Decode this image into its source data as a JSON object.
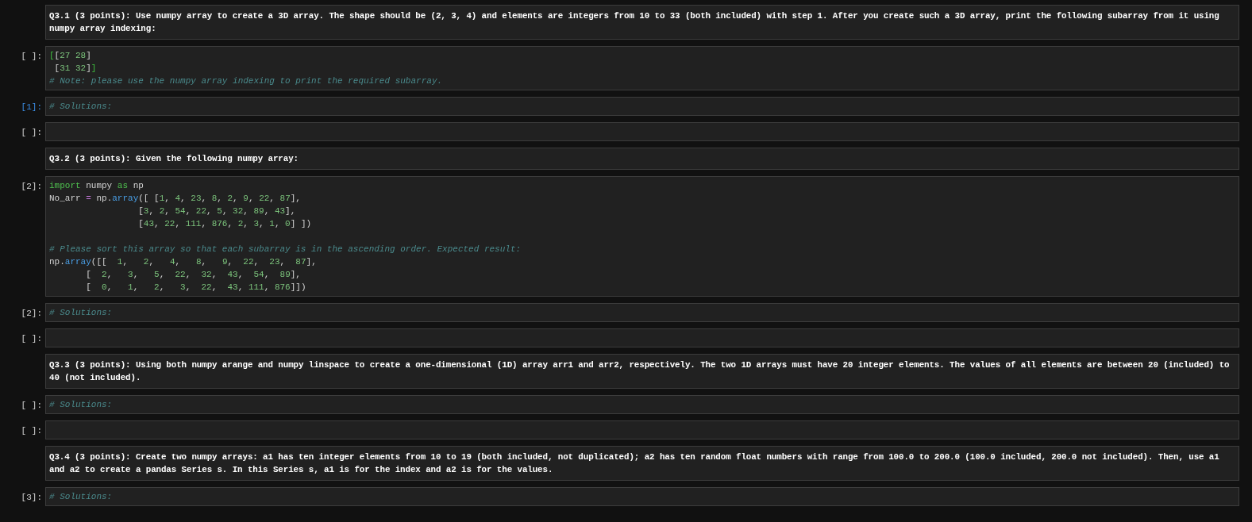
{
  "cells": [
    {
      "kind": "markdown",
      "text": "Q3.1 (3 points): Use numpy array to create a 3D array. The shape should be (2, 3, 4) and elements are integers from 10 to 33 (both included) with step 1. After you create such a 3D array, print the following subarray from it using numpy array indexing:"
    },
    {
      "kind": "code",
      "prompt": "[ ]:",
      "selected": false,
      "lines": [
        {
          "tokens": [
            {
              "text": "[",
              "kind": "bracket"
            },
            {
              "text": "[",
              "kind": "plain"
            },
            {
              "text": "27",
              "kind": "number"
            },
            {
              "text": " 28",
              "kind": "number"
            },
            {
              "text": "]",
              "kind": "plain"
            }
          ]
        },
        {
          "tokens": [
            {
              "text": " [",
              "kind": "plain"
            },
            {
              "text": "31",
              "kind": "number"
            },
            {
              "text": " 32",
              "kind": "number"
            },
            {
              "text": "]",
              "kind": "plain"
            },
            {
              "text": "]",
              "kind": "bracket"
            }
          ]
        },
        {
          "tokens": [
            {
              "text": "# Note: please use the numpy array indexing to print the required subarray.",
              "kind": "comment"
            }
          ]
        }
      ]
    },
    {
      "kind": "code",
      "prompt": "[1]:",
      "selected": true,
      "lines": [
        {
          "tokens": [
            {
              "text": "# Solutions:",
              "kind": "comment"
            }
          ]
        }
      ]
    },
    {
      "kind": "code",
      "prompt": "[ ]:",
      "selected": false
    },
    {
      "kind": "markdown",
      "text": "Q3.2 (3 points): Given the following numpy array:"
    },
    {
      "kind": "code",
      "prompt": "[2]:",
      "selected": false,
      "lines": [
        {
          "tokens": [
            {
              "text": "import",
              "kind": "keyword"
            },
            {
              "text": " numpy ",
              "kind": "plain"
            },
            {
              "text": "as",
              "kind": "keyword"
            },
            {
              "text": " np",
              "kind": "plain"
            }
          ]
        },
        {
          "tokens": [
            {
              "text": "No_arr ",
              "kind": "plain"
            },
            {
              "text": "=",
              "kind": "operator"
            },
            {
              "text": " np.",
              "kind": "plain"
            },
            {
              "text": "array",
              "kind": "function"
            },
            {
              "text": "([ [",
              "kind": "plain"
            },
            {
              "text": "1",
              "kind": "number"
            },
            {
              "text": ", ",
              "kind": "plain"
            },
            {
              "text": "4",
              "kind": "number"
            },
            {
              "text": ", ",
              "kind": "plain"
            },
            {
              "text": "23",
              "kind": "number"
            },
            {
              "text": ", ",
              "kind": "plain"
            },
            {
              "text": "8",
              "kind": "number"
            },
            {
              "text": ", ",
              "kind": "plain"
            },
            {
              "text": "2",
              "kind": "number"
            },
            {
              "text": ", ",
              "kind": "plain"
            },
            {
              "text": "9",
              "kind": "number"
            },
            {
              "text": ", ",
              "kind": "plain"
            },
            {
              "text": "22",
              "kind": "number"
            },
            {
              "text": ", ",
              "kind": "plain"
            },
            {
              "text": "87",
              "kind": "number"
            },
            {
              "text": "],",
              "kind": "plain"
            }
          ]
        },
        {
          "tokens": [
            {
              "text": "                 [",
              "kind": "plain"
            },
            {
              "text": "3",
              "kind": "number"
            },
            {
              "text": ", ",
              "kind": "plain"
            },
            {
              "text": "2",
              "kind": "number"
            },
            {
              "text": ", ",
              "kind": "plain"
            },
            {
              "text": "54",
              "kind": "number"
            },
            {
              "text": ", ",
              "kind": "plain"
            },
            {
              "text": "22",
              "kind": "number"
            },
            {
              "text": ", ",
              "kind": "plain"
            },
            {
              "text": "5",
              "kind": "number"
            },
            {
              "text": ", ",
              "kind": "plain"
            },
            {
              "text": "32",
              "kind": "number"
            },
            {
              "text": ", ",
              "kind": "plain"
            },
            {
              "text": "89",
              "kind": "number"
            },
            {
              "text": ", ",
              "kind": "plain"
            },
            {
              "text": "43",
              "kind": "number"
            },
            {
              "text": "],",
              "kind": "plain"
            }
          ]
        },
        {
          "tokens": [
            {
              "text": "                 [",
              "kind": "plain"
            },
            {
              "text": "43",
              "kind": "number"
            },
            {
              "text": ", ",
              "kind": "plain"
            },
            {
              "text": "22",
              "kind": "number"
            },
            {
              "text": ", ",
              "kind": "plain"
            },
            {
              "text": "111",
              "kind": "number"
            },
            {
              "text": ", ",
              "kind": "plain"
            },
            {
              "text": "876",
              "kind": "number"
            },
            {
              "text": ", ",
              "kind": "plain"
            },
            {
              "text": "2",
              "kind": "number"
            },
            {
              "text": ", ",
              "kind": "plain"
            },
            {
              "text": "3",
              "kind": "number"
            },
            {
              "text": ", ",
              "kind": "plain"
            },
            {
              "text": "1",
              "kind": "number"
            },
            {
              "text": ", ",
              "kind": "plain"
            },
            {
              "text": "0",
              "kind": "number"
            },
            {
              "text": "] ])",
              "kind": "plain"
            }
          ]
        },
        {
          "kind": "blank"
        },
        {
          "tokens": [
            {
              "text": "# Please sort this array so that each subarray is in the ascending order. Expected result:",
              "kind": "comment"
            }
          ]
        },
        {
          "tokens": [
            {
              "text": "np.",
              "kind": "plain"
            },
            {
              "text": "array",
              "kind": "function"
            },
            {
              "text": "([[  ",
              "kind": "plain"
            },
            {
              "text": "1",
              "kind": "number"
            },
            {
              "text": ",   ",
              "kind": "plain"
            },
            {
              "text": "2",
              "kind": "number"
            },
            {
              "text": ",   ",
              "kind": "plain"
            },
            {
              "text": "4",
              "kind": "number"
            },
            {
              "text": ",   ",
              "kind": "plain"
            },
            {
              "text": "8",
              "kind": "number"
            },
            {
              "text": ",   ",
              "kind": "plain"
            },
            {
              "text": "9",
              "kind": "number"
            },
            {
              "text": ",  ",
              "kind": "plain"
            },
            {
              "text": "22",
              "kind": "number"
            },
            {
              "text": ",  ",
              "kind": "plain"
            },
            {
              "text": "23",
              "kind": "number"
            },
            {
              "text": ",  ",
              "kind": "plain"
            },
            {
              "text": "87",
              "kind": "number"
            },
            {
              "text": "],",
              "kind": "plain"
            }
          ]
        },
        {
          "tokens": [
            {
              "text": "       [  ",
              "kind": "plain"
            },
            {
              "text": "2",
              "kind": "number"
            },
            {
              "text": ",   ",
              "kind": "plain"
            },
            {
              "text": "3",
              "kind": "number"
            },
            {
              "text": ",   ",
              "kind": "plain"
            },
            {
              "text": "5",
              "kind": "number"
            },
            {
              "text": ",  ",
              "kind": "plain"
            },
            {
              "text": "22",
              "kind": "number"
            },
            {
              "text": ",  ",
              "kind": "plain"
            },
            {
              "text": "32",
              "kind": "number"
            },
            {
              "text": ",  ",
              "kind": "plain"
            },
            {
              "text": "43",
              "kind": "number"
            },
            {
              "text": ",  ",
              "kind": "plain"
            },
            {
              "text": "54",
              "kind": "number"
            },
            {
              "text": ",  ",
              "kind": "plain"
            },
            {
              "text": "89",
              "kind": "number"
            },
            {
              "text": "],",
              "kind": "plain"
            }
          ]
        },
        {
          "tokens": [
            {
              "text": "       [  ",
              "kind": "plain"
            },
            {
              "text": "0",
              "kind": "number"
            },
            {
              "text": ",   ",
              "kind": "plain"
            },
            {
              "text": "1",
              "kind": "number"
            },
            {
              "text": ",   ",
              "kind": "plain"
            },
            {
              "text": "2",
              "kind": "number"
            },
            {
              "text": ",   ",
              "kind": "plain"
            },
            {
              "text": "3",
              "kind": "number"
            },
            {
              "text": ",  ",
              "kind": "plain"
            },
            {
              "text": "22",
              "kind": "number"
            },
            {
              "text": ",  ",
              "kind": "plain"
            },
            {
              "text": "43",
              "kind": "number"
            },
            {
              "text": ", ",
              "kind": "plain"
            },
            {
              "text": "111",
              "kind": "number"
            },
            {
              "text": ", ",
              "kind": "plain"
            },
            {
              "text": "876",
              "kind": "number"
            },
            {
              "text": "]])",
              "kind": "plain"
            }
          ]
        }
      ]
    },
    {
      "kind": "code",
      "prompt": "[2]:",
      "selected": false,
      "lines": [
        {
          "tokens": [
            {
              "text": "# Solutions:",
              "kind": "comment"
            }
          ]
        }
      ]
    },
    {
      "kind": "code",
      "prompt": "[ ]:",
      "selected": false
    },
    {
      "kind": "markdown",
      "text": "Q3.3 (3 points): Using both numpy arange and numpy linspace to create a one-dimensional (1D) array arr1 and arr2, respectively. The two 1D arrays must have 20 integer elements. The values of all elements are between 20 (included) to 40 (not included)."
    },
    {
      "kind": "code",
      "prompt": "[ ]:",
      "selected": false,
      "lines": [
        {
          "tokens": [
            {
              "text": "# Solutions:",
              "kind": "comment"
            }
          ]
        }
      ]
    },
    {
      "kind": "code",
      "prompt": "[ ]:",
      "selected": false
    },
    {
      "kind": "markdown",
      "text": "Q3.4 (3 points): Create two numpy arrays: a1 has ten integer elements from 10 to 19 (both included, not duplicated); a2 has ten random float numbers with range from 100.0 to 200.0 (100.0 included, 200.0 not included). Then, use a1 and a2 to create a pandas Series s. In this Series s, a1 is for the index and a2 is for the values."
    },
    {
      "kind": "code",
      "prompt": "[3]:",
      "selected": false,
      "lines": [
        {
          "tokens": [
            {
              "text": "# Solutions:",
              "kind": "comment"
            }
          ]
        }
      ]
    }
  ]
}
